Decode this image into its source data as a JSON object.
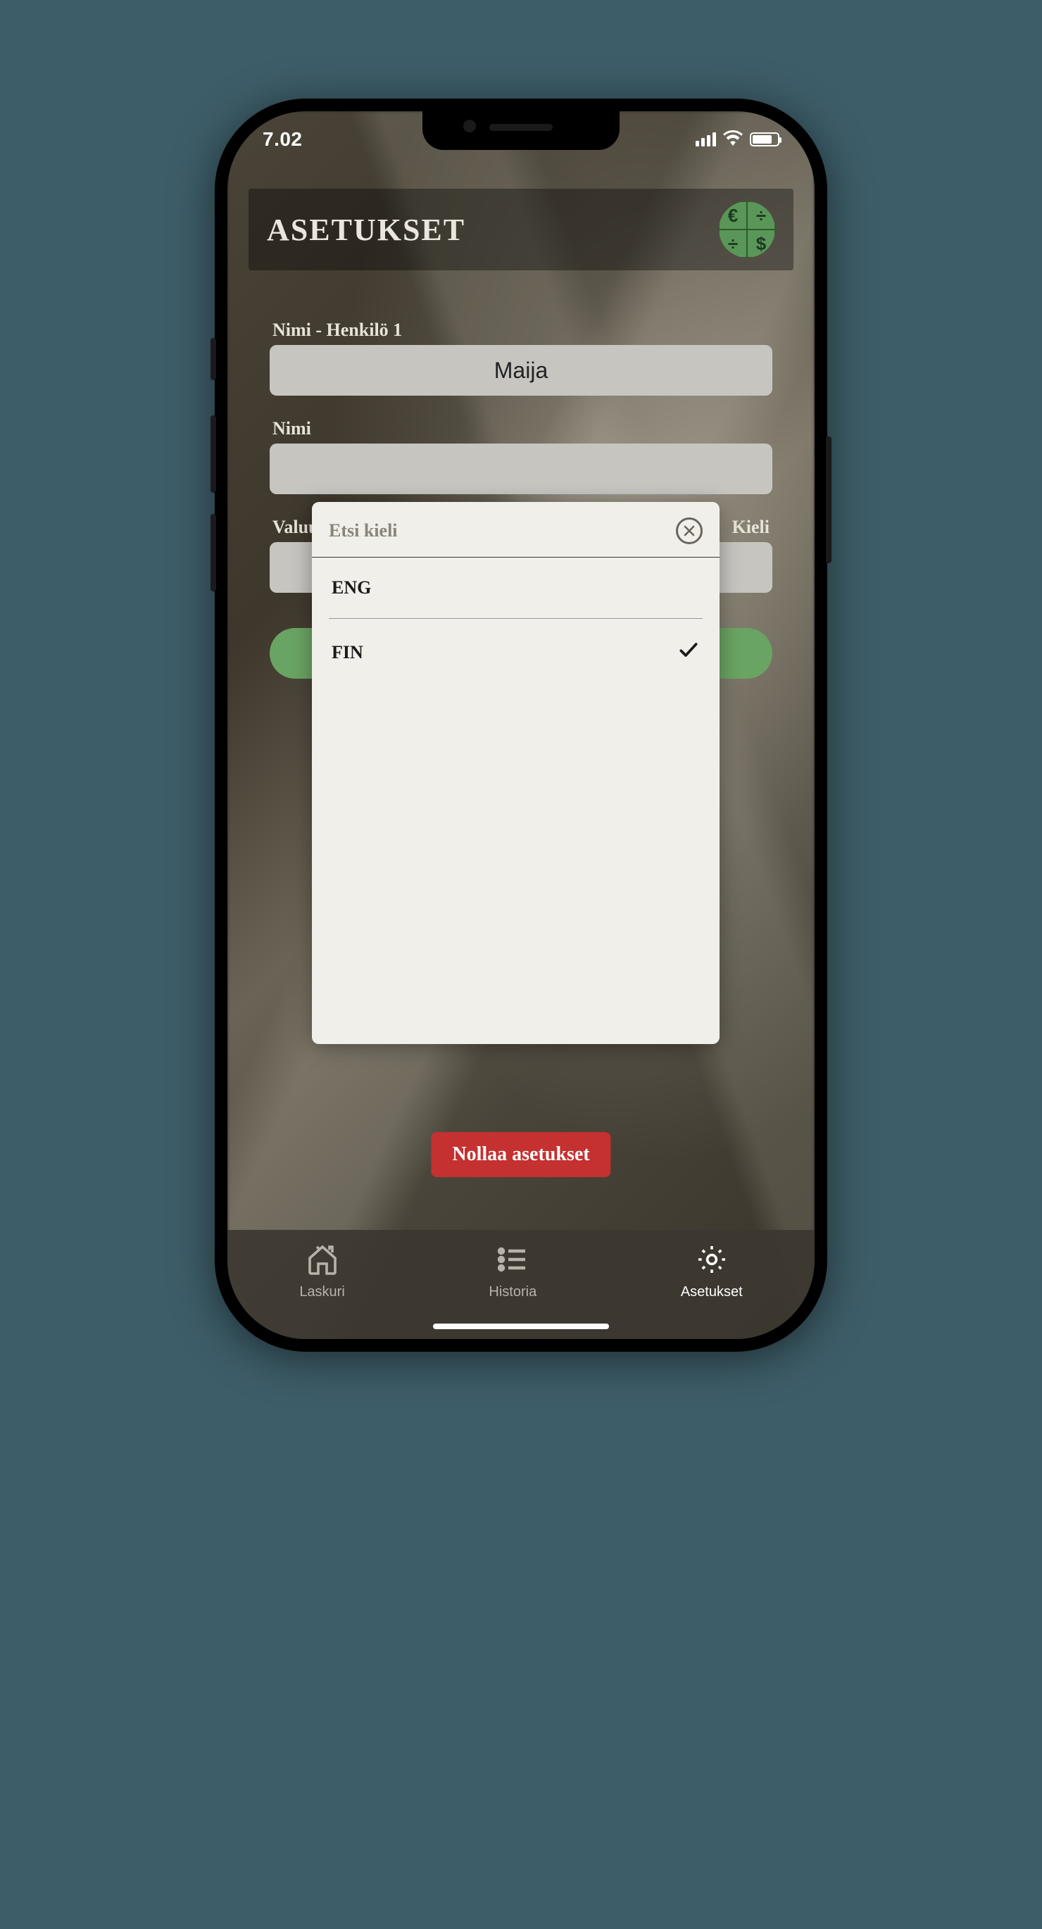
{
  "status": {
    "time": "7.02"
  },
  "header": {
    "title": "ASETUKSET",
    "logo": {
      "tl": "€",
      "tr": "÷",
      "bl": "÷",
      "br": "$"
    }
  },
  "form": {
    "person1_label": "Nimi - Henkilö 1",
    "person1_value": "Maija",
    "person2_label": "Nimi",
    "currency_label": "Valuu",
    "language_label": "Kieli"
  },
  "reset_button": "Nollaa asetukset",
  "tabs": {
    "calculator": "Laskuri",
    "history": "Historia",
    "settings": "Asetukset"
  },
  "modal": {
    "search_placeholder": "Etsi kieli",
    "options": [
      {
        "code": "ENG",
        "selected": false
      },
      {
        "code": "FIN",
        "selected": true
      }
    ]
  }
}
